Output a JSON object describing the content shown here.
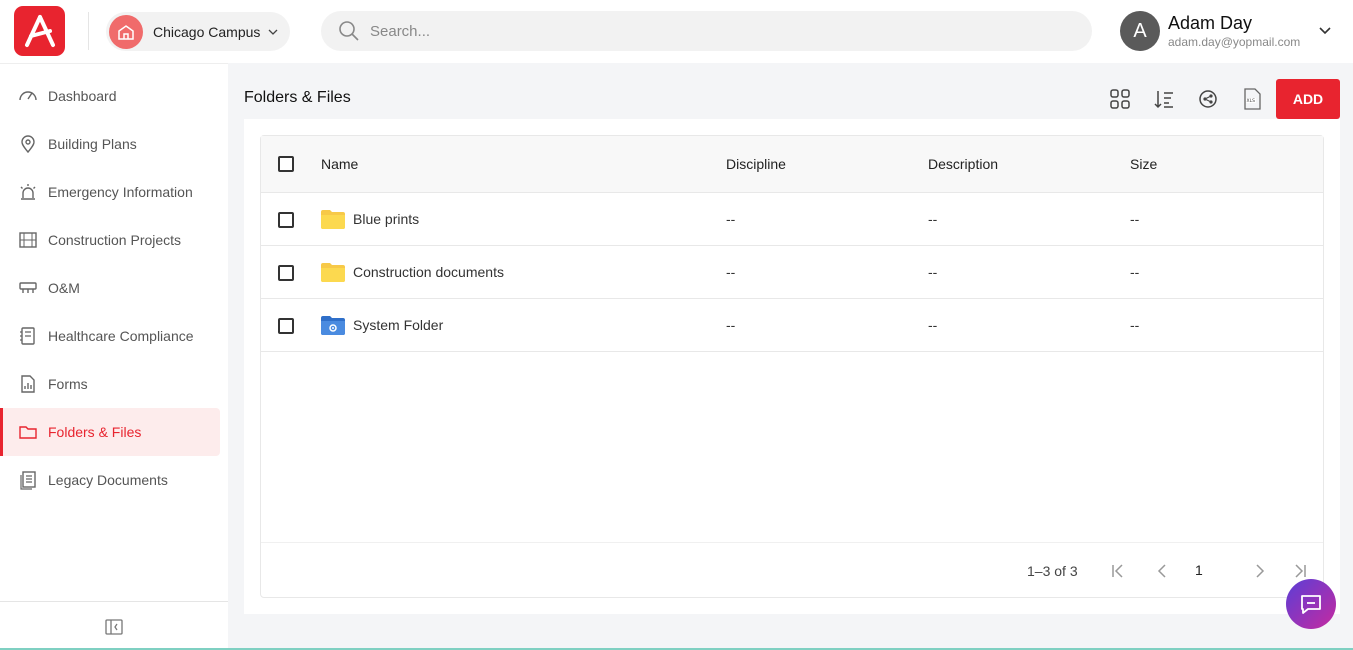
{
  "header": {
    "campus_label": "Chicago Campus",
    "search_placeholder": "Search...",
    "user": {
      "initial": "A",
      "name": "Adam Day",
      "email": "adam.day@yopmail.com"
    }
  },
  "sidebar": {
    "items": [
      {
        "label": "Dashboard",
        "icon": "gauge-icon"
      },
      {
        "label": "Building Plans",
        "icon": "map-pin-icon"
      },
      {
        "label": "Emergency Information",
        "icon": "alarm-light-icon"
      },
      {
        "label": "Construction Projects",
        "icon": "construction-icon"
      },
      {
        "label": "O&M",
        "icon": "operations-icon"
      },
      {
        "label": "Healthcare Compliance",
        "icon": "notebook-icon"
      },
      {
        "label": "Forms",
        "icon": "form-chart-icon"
      },
      {
        "label": "Folders & Files",
        "icon": "folder-icon",
        "active": true
      },
      {
        "label": "Legacy Documents",
        "icon": "documents-icon"
      }
    ]
  },
  "main": {
    "title": "Folders & Files",
    "add_label": "ADD",
    "table": {
      "columns": [
        "Name",
        "Discipline",
        "Description",
        "Size"
      ],
      "rows": [
        {
          "name": "Blue prints",
          "type": "folder",
          "discipline": "--",
          "description": "--",
          "size": "--"
        },
        {
          "name": "Construction documents",
          "type": "folder",
          "discipline": "--",
          "description": "--",
          "size": "--"
        },
        {
          "name": "System Folder",
          "type": "system-folder",
          "discipline": "--",
          "description": "--",
          "size": "--"
        }
      ]
    },
    "pagination": {
      "range": "1–3 of 3",
      "current_page": "1"
    }
  },
  "colors": {
    "brand": "#e8242f",
    "folder": "#f7c948",
    "system_folder": "#3b7dd8"
  }
}
